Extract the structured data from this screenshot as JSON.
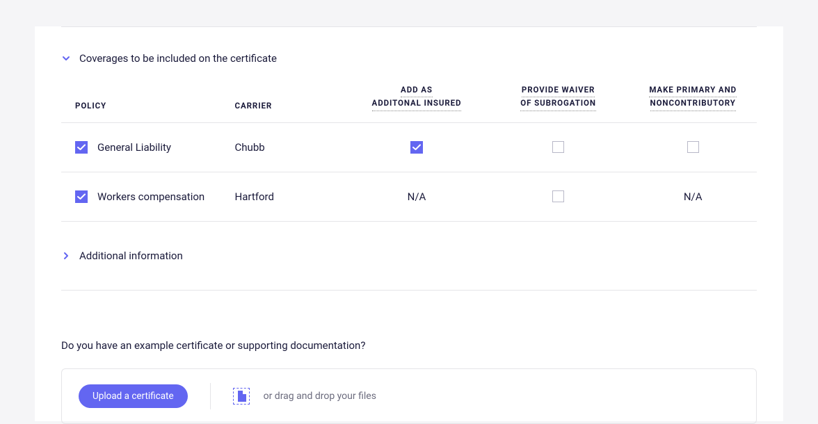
{
  "sections": {
    "coverages": {
      "title": "Coverages to be included on the certificate",
      "expanded": true
    },
    "additional_info": {
      "title": "Additional information",
      "expanded": false
    }
  },
  "table": {
    "headers": {
      "policy": "POLICY",
      "carrier": "CARRIER",
      "insured_line1": "ADD AS",
      "insured_line2": "ADDITONAL INSURED",
      "waiver_line1": "PROVIDE WAIVER",
      "waiver_line2": "OF SUBROGATION",
      "primary_line1": "MAKE PRIMARY AND",
      "primary_line2": "NONCONTRIBUTORY"
    },
    "rows": [
      {
        "selected": true,
        "policy": "General Liability",
        "carrier": "Chubb",
        "insured": "checked",
        "waiver": "unchecked",
        "primary": "unchecked"
      },
      {
        "selected": true,
        "policy": "Workers compensation",
        "carrier": "Hartford",
        "insured": "N/A",
        "waiver": "unchecked",
        "primary": "N/A"
      }
    ]
  },
  "upload": {
    "question": "Do you have an example certificate or supporting documentation?",
    "button_label": "Upload a certificate",
    "drag_text": "or drag and drop your files"
  }
}
